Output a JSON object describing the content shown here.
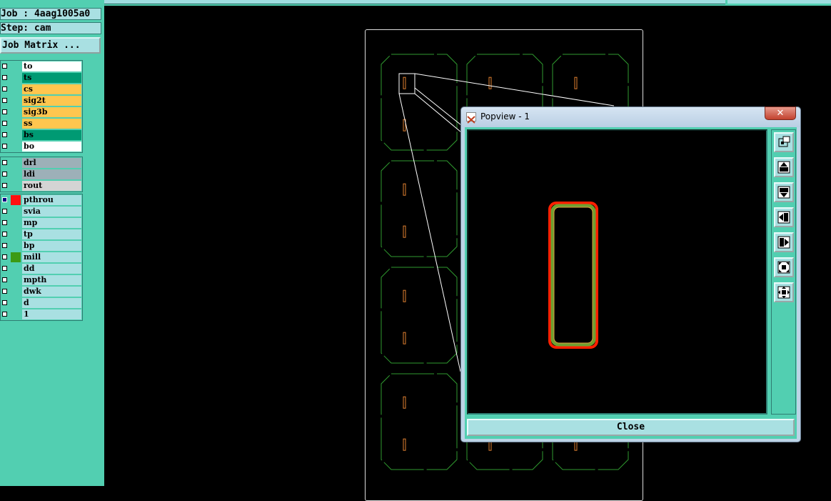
{
  "job": {
    "label": "Job : 4aag1005a0"
  },
  "step": {
    "label": "Step: cam"
  },
  "job_matrix_button": "Job Matrix ...",
  "colors": {
    "panel": "#52cfb1",
    "field": "#a9e0e2",
    "signal": "#ffc64f",
    "solder": "#009a73",
    "white": "#ffffff",
    "drill": "#9db0b8",
    "rout": "#d4d4d4",
    "profile_green": "#2f9a2f",
    "pad_orange": "#e08030",
    "highlight_red": "#ff2000"
  },
  "layer_groups": [
    {
      "layers": [
        {
          "name": "to",
          "bg": "#ffffff",
          "swatch": ""
        },
        {
          "name": "ts",
          "bg": "#009a73",
          "swatch": ""
        },
        {
          "name": "cs",
          "bg": "#ffc64f",
          "swatch": ""
        },
        {
          "name": "sig2t",
          "bg": "#ffc64f",
          "swatch": ""
        },
        {
          "name": "sig3b",
          "bg": "#ffc64f",
          "swatch": ""
        },
        {
          "name": "ss",
          "bg": "#ffc64f",
          "swatch": ""
        },
        {
          "name": "bs",
          "bg": "#009a73",
          "swatch": ""
        },
        {
          "name": "bo",
          "bg": "#ffffff",
          "swatch": ""
        }
      ]
    },
    {
      "layers": [
        {
          "name": "drl",
          "bg": "#9db0b8",
          "swatch": ""
        },
        {
          "name": "ldi",
          "bg": "#9db0b8",
          "swatch": ""
        },
        {
          "name": "rout",
          "bg": "#d4d4d4",
          "swatch": ""
        }
      ]
    },
    {
      "layers": [
        {
          "name": "pthrou",
          "bg": "#a9e0e2",
          "swatch": "#ff1010",
          "checked": true
        },
        {
          "name": "svia",
          "bg": "#a9e0e2",
          "swatch": ""
        },
        {
          "name": "mp",
          "bg": "#a9e0e2",
          "swatch": ""
        },
        {
          "name": "tp",
          "bg": "#a9e0e2",
          "swatch": ""
        },
        {
          "name": "bp",
          "bg": "#a9e0e2",
          "swatch": ""
        },
        {
          "name": "mill",
          "bg": "#a9e0e2",
          "swatch": "#3c9a14"
        },
        {
          "name": "dd",
          "bg": "#a9e0e2",
          "swatch": ""
        },
        {
          "name": "mpth",
          "bg": "#a9e0e2",
          "swatch": ""
        },
        {
          "name": "dwk",
          "bg": "#a9e0e2",
          "swatch": ""
        },
        {
          "name": "d",
          "bg": "#a9e0e2",
          "swatch": ""
        },
        {
          "name": "1",
          "bg": "#a9e0e2",
          "swatch": ""
        }
      ]
    }
  ],
  "popview": {
    "title": "Popview - 1",
    "close_x": "✕",
    "close_button": "Close",
    "tools": [
      "zoom-fit-icon",
      "pan-up-icon",
      "pan-down-icon",
      "pan-left-icon",
      "pan-right-icon",
      "zoom-out-icon",
      "zoom-in-icon"
    ]
  }
}
